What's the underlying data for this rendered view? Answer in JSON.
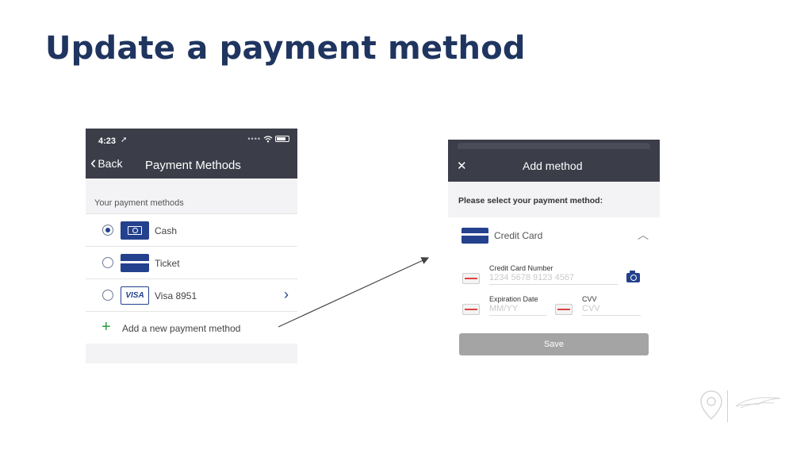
{
  "slide": {
    "title": "Update a payment method"
  },
  "left_phone": {
    "status": {
      "time": "4:23",
      "location_glyph": "➚"
    },
    "nav": {
      "back_label": "Back",
      "title": "Payment Methods"
    },
    "section_label": "Your payment methods",
    "methods": [
      {
        "label": "Cash",
        "icon": "cash-icon",
        "selected": true
      },
      {
        "label": "Ticket",
        "icon": "ticket-icon",
        "selected": false
      },
      {
        "label": "Visa 8951",
        "icon": "visa-card-icon",
        "icon_text": "VISA",
        "selected": false
      }
    ],
    "add_label": "Add a new payment method"
  },
  "right_phone": {
    "title": "Add method",
    "prompt": "Please select your payment method:",
    "method_label": "Credit Card",
    "card_number": {
      "label": "Credit Card Number",
      "placeholder": "1234 5678 9123 4567"
    },
    "expiration": {
      "label": "Expiration Date",
      "placeholder": "MM/YY"
    },
    "cvv": {
      "label": "CVV",
      "placeholder": "CVV"
    },
    "save_label": "Save"
  },
  "colors": {
    "title_navy": "#1f3560",
    "header_dark": "#3b3d49",
    "accent_blue": "#24418d",
    "add_green": "#2e9a3e",
    "save_gray": "#a4a4a4"
  }
}
